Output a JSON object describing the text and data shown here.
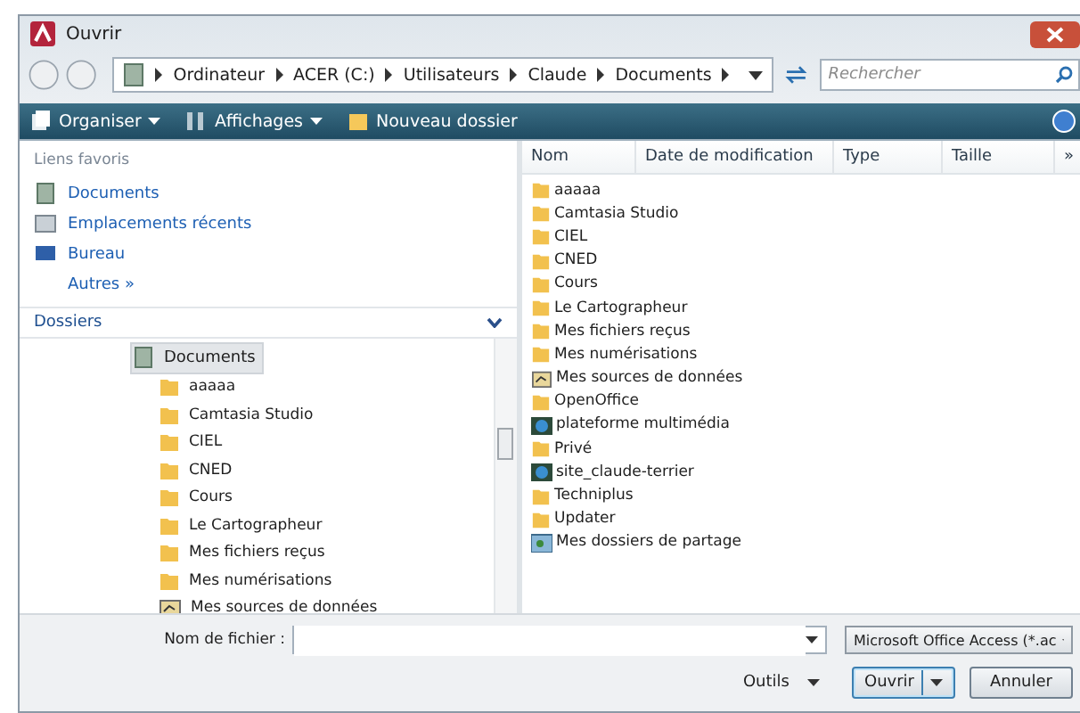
{
  "window": {
    "title": "Ouvrir"
  },
  "address": {
    "segments": [
      "Ordinateur",
      "ACER (C:)",
      "Utilisateurs",
      "Claude",
      "Documents"
    ]
  },
  "search": {
    "placeholder": "Rechercher"
  },
  "toolbar": [
    {
      "label": "Organiser",
      "kind": "organize",
      "dropdown": true
    },
    {
      "label": "Affichages",
      "kind": "views",
      "dropdown": true
    },
    {
      "label": "Nouveau dossier",
      "kind": "newfolder",
      "dropdown": false
    }
  ],
  "favorites": {
    "title": "Liens favoris",
    "items": [
      {
        "label": "Documents",
        "kind": "documents"
      },
      {
        "label": "Emplacements récents",
        "kind": "recent"
      },
      {
        "label": "Bureau",
        "kind": "desktop"
      },
      {
        "label": "Autres »",
        "kind": "more"
      }
    ]
  },
  "folders": {
    "title": "Dossiers",
    "tree": [
      {
        "label": "Documents",
        "kind": "documents",
        "selected": true,
        "children": [
          {
            "label": "aaaaa",
            "kind": "folder",
            "selected": false
          },
          {
            "label": "Camtasia Studio",
            "kind": "folder",
            "selected": false
          },
          {
            "label": "CIEL",
            "kind": "folder",
            "selected": false
          },
          {
            "label": "CNED",
            "kind": "folder",
            "selected": false
          },
          {
            "label": "Cours",
            "kind": "folder",
            "selected": false
          },
          {
            "label": "Le Cartographeur",
            "kind": "folder",
            "selected": false
          },
          {
            "label": "Mes fichiers reçus",
            "kind": "folder",
            "selected": false
          },
          {
            "label": "Mes numérisations",
            "kind": "folder",
            "selected": false
          },
          {
            "label": "Mes sources de données",
            "kind": "datasource",
            "selected": false
          }
        ]
      }
    ]
  },
  "file_list": {
    "columns": [
      "Nom",
      "Date de modification",
      "Type",
      "Taille",
      "»"
    ],
    "rows": [
      {
        "name": "aaaaa",
        "kind": "folder"
      },
      {
        "name": "Camtasia Studio",
        "kind": "folder"
      },
      {
        "name": "CIEL",
        "kind": "folder"
      },
      {
        "name": "CNED",
        "kind": "folder"
      },
      {
        "name": "Cours",
        "kind": "folder"
      },
      {
        "name": "Le Cartographeur",
        "kind": "folder"
      },
      {
        "name": "Mes fichiers reçus",
        "kind": "folder"
      },
      {
        "name": "Mes numérisations",
        "kind": "folder"
      },
      {
        "name": "Mes sources de données",
        "kind": "datasource"
      },
      {
        "name": "OpenOffice",
        "kind": "folder"
      },
      {
        "name": "plateforme multimédia",
        "kind": "web"
      },
      {
        "name": "Privé",
        "kind": "folder"
      },
      {
        "name": "site_claude-terrier",
        "kind": "web"
      },
      {
        "name": "Techniplus",
        "kind": "folder"
      },
      {
        "name": "Updater",
        "kind": "folder"
      },
      {
        "name": "Mes dossiers de partage",
        "kind": "share"
      }
    ]
  },
  "filename": {
    "label": "Nom de fichier :"
  },
  "filetype": {
    "value": "Microsoft Office Access (*.ac"
  },
  "tools": {
    "label": "Outils"
  },
  "buttons": [
    {
      "label": "Ouvrir",
      "kind": "split"
    },
    {
      "label": "Annuler",
      "kind": "plain"
    }
  ]
}
